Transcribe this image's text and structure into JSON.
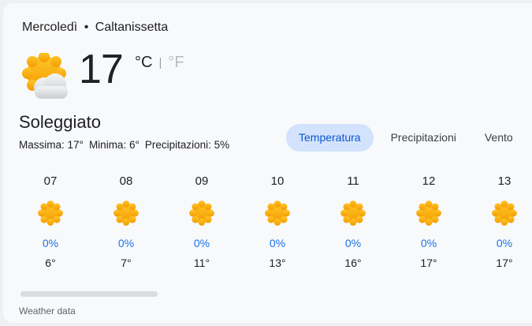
{
  "header": {
    "day": "Mercoledì",
    "separator": "•",
    "location": "Caltanissetta"
  },
  "current": {
    "icon": "partly-cloudy-icon",
    "temperature": "17",
    "unit_active": "°C",
    "unit_separator": "|",
    "unit_inactive": "°F",
    "condition": "Soleggiato",
    "max": "Massima: 17°",
    "min": "Minima: 6°",
    "precipitation": "Precipitazioni: 5%"
  },
  "tabs": [
    "Temperatura",
    "Precipitazioni",
    "Vento"
  ],
  "active_tab": "Temperatura",
  "hourly": [
    {
      "hour": "07",
      "icon": "sun-icon",
      "precip": "0%",
      "temp": "6°"
    },
    {
      "hour": "08",
      "icon": "sun-icon",
      "precip": "0%",
      "temp": "7°"
    },
    {
      "hour": "09",
      "icon": "sun-icon",
      "precip": "0%",
      "temp": "11°"
    },
    {
      "hour": "10",
      "icon": "sun-icon",
      "precip": "0%",
      "temp": "13°"
    },
    {
      "hour": "11",
      "icon": "sun-icon",
      "precip": "0%",
      "temp": "16°"
    },
    {
      "hour": "12",
      "icon": "sun-icon",
      "precip": "0%",
      "temp": "17°"
    },
    {
      "hour": "13",
      "icon": "sun-icon",
      "precip": "0%",
      "temp": "17°"
    }
  ],
  "footer": "Weather data",
  "colors": {
    "accent": "#0b57d0",
    "active_tab_bg": "#d3e3fd",
    "precip": "#1a73e8",
    "sun": "#f6a500"
  }
}
